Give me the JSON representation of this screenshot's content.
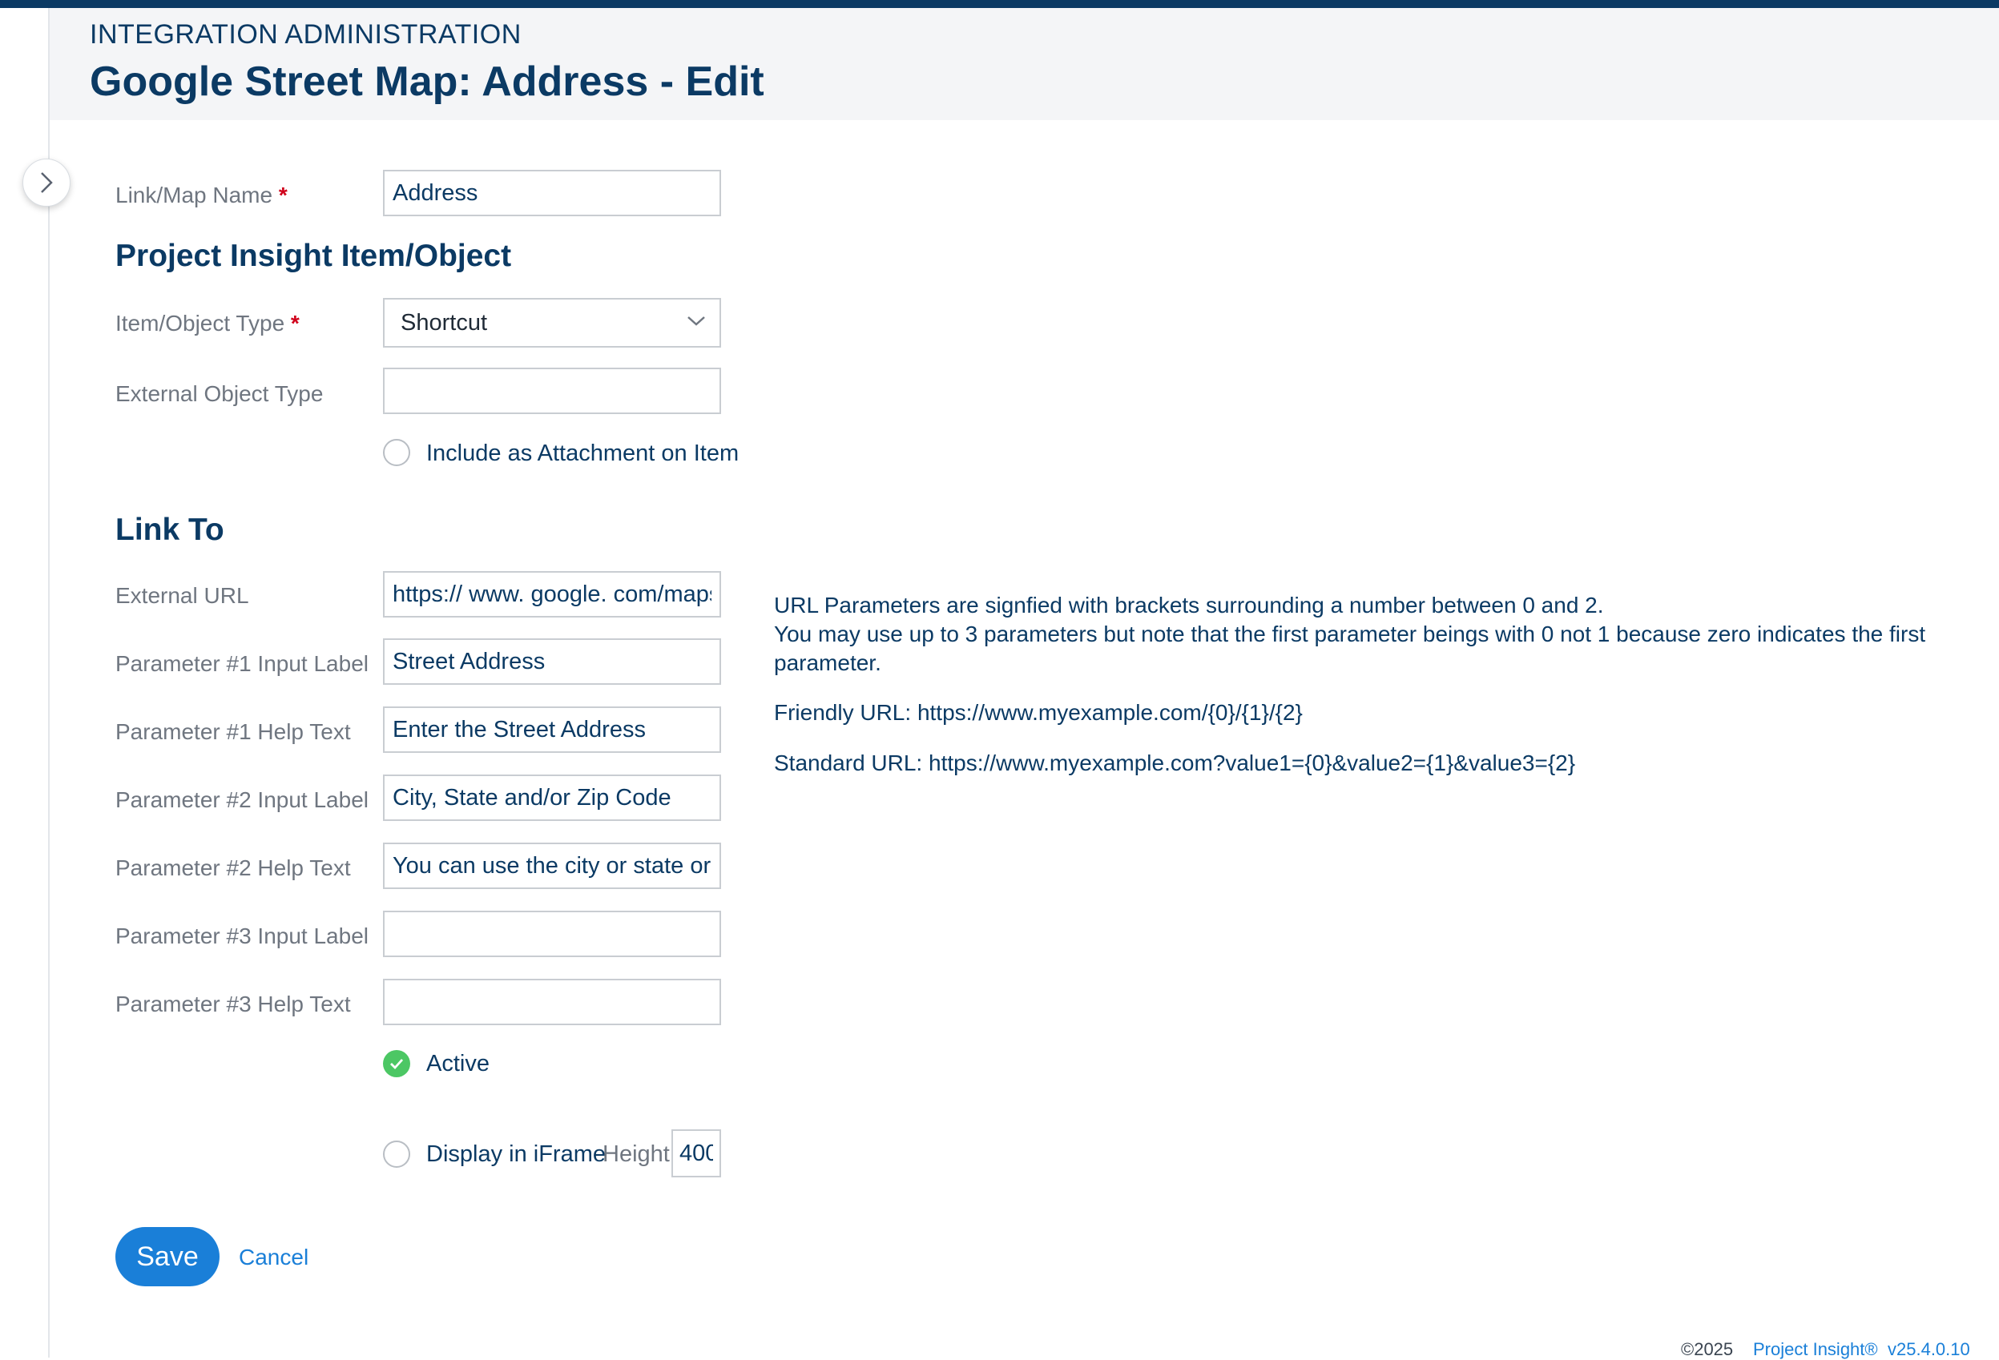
{
  "header": {
    "breadcrumb": "INTEGRATION ADMINISTRATION",
    "title": "Google Street Map: Address - Edit"
  },
  "form": {
    "link_map_name": {
      "label": "Link/Map Name",
      "required_mark": "*",
      "value": "Address"
    },
    "section_item": "Project Insight Item/Object",
    "item_object_type": {
      "label": "Item/Object Type",
      "required_mark": "*",
      "selected": "Shortcut"
    },
    "external_object_type": {
      "label": "External Object Type",
      "value": ""
    },
    "include_attachment": {
      "label": "Include as Attachment on Item",
      "checked": false
    },
    "section_link": "Link To",
    "external_url": {
      "label": "External URL",
      "value": "https:// www. google. com/maps"
    },
    "param1_label": {
      "label": "Parameter #1 Input Label",
      "value": "Street Address"
    },
    "param1_help": {
      "label": "Parameter #1 Help Text",
      "value": "Enter the Street Address"
    },
    "param2_label": {
      "label": "Parameter #2 Input Label",
      "value": "City, State and/or Zip Code"
    },
    "param2_help": {
      "label": "Parameter #2 Help Text",
      "value": "You can use the city or state or just the zip code"
    },
    "param3_label": {
      "label": "Parameter #3 Input Label",
      "value": ""
    },
    "param3_help": {
      "label": "Parameter #3 Help Text",
      "value": ""
    },
    "active": {
      "label": "Active",
      "checked": true
    },
    "iframe": {
      "label": "Display in iFrame",
      "checked": false,
      "height_label": "Height",
      "height_value": "400"
    }
  },
  "help": {
    "line1": "URL Parameters are signfied with brackets surrounding a number between 0 and 2.",
    "line2": "You may use up to 3 parameters but note that the first parameter beings with 0 not 1 because zero indicates the first parameter.",
    "friendly": "Friendly URL: https://www.myexample.com/{0}/{1}/{2}",
    "standard": "Standard URL: https://www.myexample.com?value1={0}&value2={1}&value3={2}"
  },
  "actions": {
    "save": "Save",
    "cancel": "Cancel"
  },
  "footer": {
    "copyright": "©2025",
    "brand": "Project Insight®",
    "version": "v25.4.0.10"
  },
  "colors": {
    "primary": "#0b3a64",
    "accent": "#1a7fd8",
    "required": "#d0021b",
    "active": "#4cc764"
  },
  "icons": {
    "toggle": "chevron-right-icon",
    "select": "chevron-down-icon",
    "active": "check-icon"
  }
}
